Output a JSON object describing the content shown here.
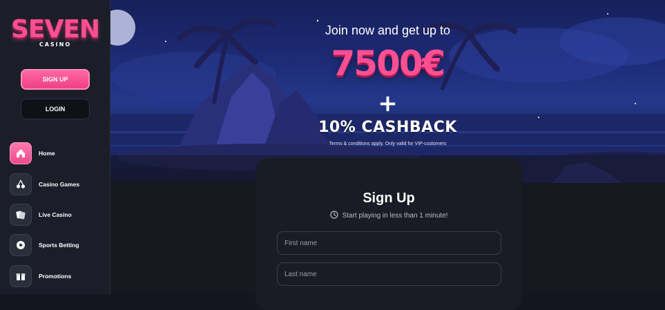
{
  "sidebar": {
    "logo": {
      "title": "SEVEN",
      "subtitle": "CASINO"
    },
    "signup_label": "SIGN UP",
    "login_label": "LOGIN",
    "nav": [
      {
        "label": "Home",
        "icon": "home-icon",
        "active": true
      },
      {
        "label": "Casino Games",
        "icon": "cherries-icon",
        "active": false
      },
      {
        "label": "Live Casino",
        "icon": "cards-icon",
        "active": false
      },
      {
        "label": "Sports Betting",
        "icon": "soccer-ball-icon",
        "active": false
      },
      {
        "label": "Promotions",
        "icon": "gift-icon",
        "active": false
      }
    ]
  },
  "hero": {
    "headline": "Join now and get up to",
    "amount": "7500€",
    "plus": "+",
    "cashback": "10% CASHBACK",
    "terms": "Terms & conditions apply. Only valid for VIP-customers"
  },
  "form": {
    "title": "Sign Up",
    "subtitle": "Start playing in less than 1 minute!",
    "subtitle_icon": "clock-icon",
    "fields": [
      {
        "placeholder": "First name"
      },
      {
        "placeholder": "Last name"
      }
    ]
  },
  "colors": {
    "accent_pink": "#ff4f93",
    "sidebar_bg": "#1b1e28",
    "page_bg": "#14161f"
  }
}
